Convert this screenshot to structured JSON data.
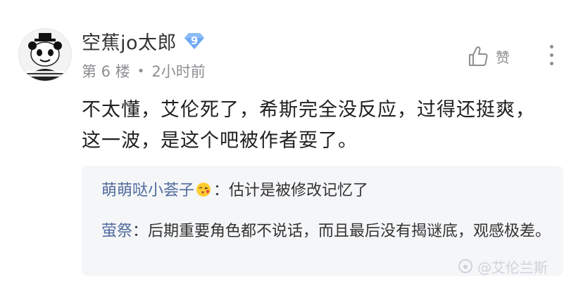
{
  "post": {
    "username": "空蕉jo太郎",
    "level": "9",
    "floor": "第 6 楼",
    "time": "2小时前",
    "like_label": "赞",
    "content": "不太懂，艾伦死了，希斯完全没反应，过得还挺爽，这一波，是这个吧被作者耍了。"
  },
  "replies": [
    {
      "author": "萌萌哒小荟子",
      "emoji": "blowing-kiss-face",
      "separator": "：",
      "text": "估计是被修改记忆了"
    },
    {
      "author": "萤祭",
      "separator": "：",
      "text": "后期重要角色都不说话，而且最后没有揭谜底，观感极差。"
    }
  ],
  "watermark": "@艾伦兰斯",
  "colors": {
    "username": "#333333",
    "meta": "#8e8e93",
    "reply_author": "#506b9e",
    "reply_bg": "#f5f6f8",
    "level_badge": "#6fa8f5"
  }
}
